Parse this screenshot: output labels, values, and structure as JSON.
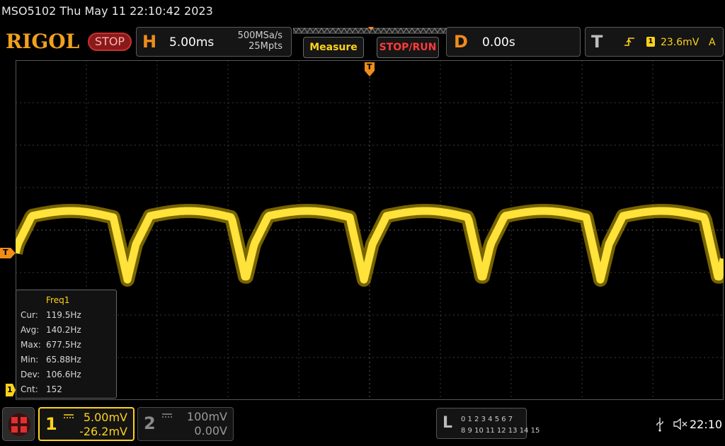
{
  "titlebar": {
    "text": "MSO5102  Thu May 11 22:10:42 2023"
  },
  "header": {
    "logo": "RIGOL",
    "run_state": "STOP",
    "horizontal": {
      "letter": "H",
      "scale": "5.00ms",
      "sample_rate": "500MSa/s",
      "memory_depth": "25Mpts"
    },
    "measure_label": "Measure",
    "stop_run_label": "STOP/RUN",
    "delay": {
      "letter": "D",
      "value": "0.00s"
    },
    "trigger": {
      "letter": "T",
      "source": "1",
      "level": "23.6mV",
      "mode": "A"
    }
  },
  "markers": {
    "trigger_pos": "T",
    "trigger_level": "T",
    "ch1_ground": "1"
  },
  "measurement": {
    "name": "Freq1",
    "rows": [
      {
        "label": "Cur:",
        "value": "119.5Hz"
      },
      {
        "label": "Avg:",
        "value": "140.2Hz"
      },
      {
        "label": "Max:",
        "value": "677.5Hz"
      },
      {
        "label": "Min:",
        "value": "65.88Hz"
      },
      {
        "label": "Dev:",
        "value": "106.6Hz"
      },
      {
        "label": "Cnt:",
        "value": "152"
      }
    ]
  },
  "channels": [
    {
      "num": "1",
      "scale": "5.00mV",
      "offset": "-26.2mV",
      "color": "#ffd21a",
      "active": true
    },
    {
      "num": "2",
      "scale": "100mV",
      "offset": "0.00V",
      "color": "#8a8a8a",
      "active": false
    }
  ],
  "logic": {
    "letter": "L",
    "row1": "0 1 2 3   4 5 6 7",
    "row2": "8  9 10 11  12 13 14 15"
  },
  "status": {
    "time": "22:10",
    "usb_icon": "usb-icon",
    "mute_icon": "speaker-muted-icon"
  },
  "colors": {
    "ch1": "#ffd21a",
    "accent": "#f08c1a",
    "stop": "#ff3b3b",
    "grid": "#3c3c3c"
  }
}
